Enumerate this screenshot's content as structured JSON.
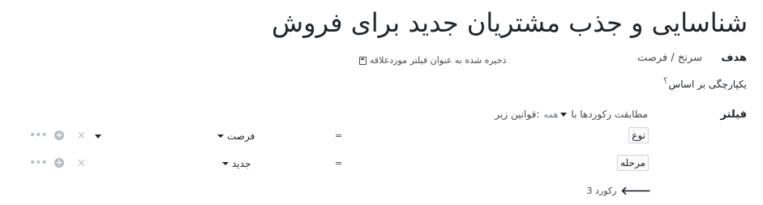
{
  "title": "شناسایی و جذب مشتریان جدید برای فروش",
  "target": {
    "label": "هدف",
    "value": "سرنخ / فرصت"
  },
  "save_favorite": {
    "label": "ذخیره شده به عنوان فیلتر موردعلاقه",
    "icon": "save-icon"
  },
  "integrity": {
    "label": "یکپارچگی بر اساس",
    "help": "؟"
  },
  "filter": {
    "label": "فیلتر",
    "match_prefix": "مطابقت رکوردها با",
    "match_value": "همه",
    "match_suffix": "قوانین زیر:",
    "rules": [
      {
        "field": "نوع",
        "operator": "=",
        "value": "فرصت",
        "has_dropdown": true
      },
      {
        "field": "مرحله",
        "operator": "=",
        "value": "جدید",
        "has_dropdown": false
      }
    ]
  },
  "records": {
    "label": "3 رکورد",
    "icon": "arrow-left-icon"
  }
}
